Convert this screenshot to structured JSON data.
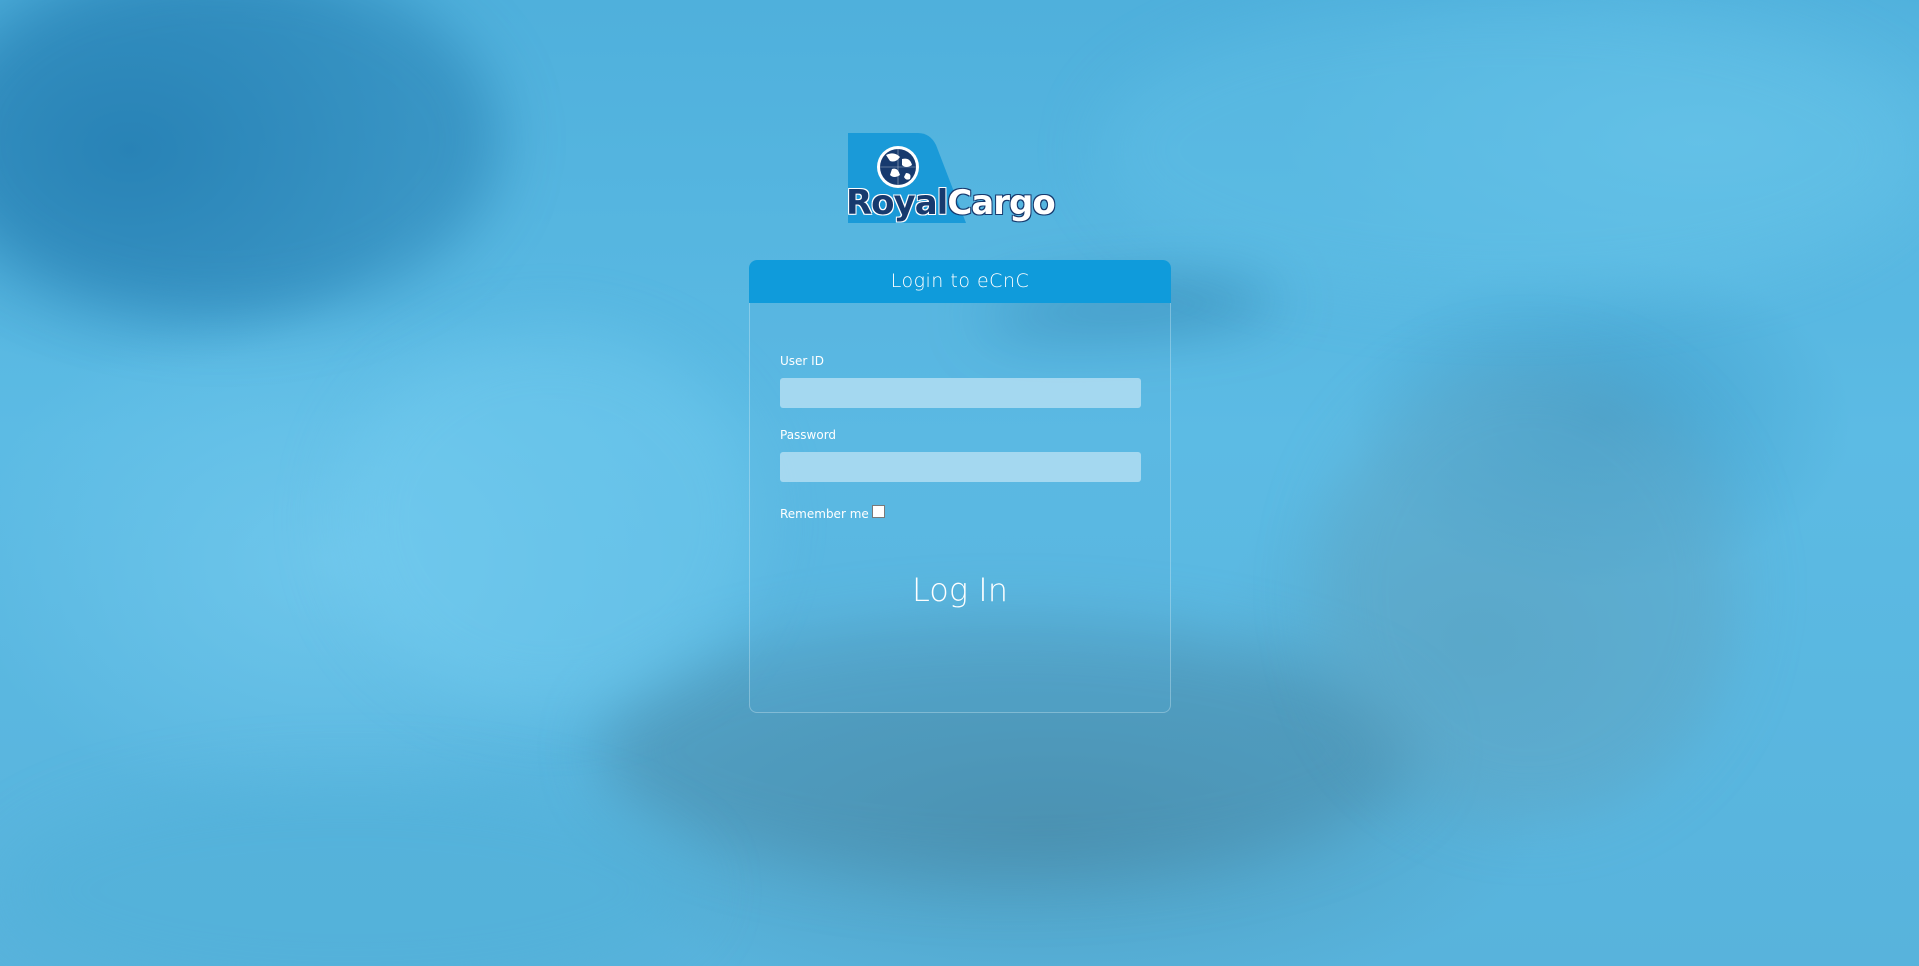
{
  "brand": {
    "logo_royal": "Royal",
    "logo_cargo": "Cargo",
    "logo_icon": "globe-icon",
    "colors": {
      "navy": "#173a6e",
      "accent": "#0f9bdb"
    }
  },
  "login": {
    "title": "Login to eCnC",
    "user_id_label": "User ID",
    "user_id_value": "",
    "password_label": "Password",
    "password_value": "",
    "remember_label": "Remember me",
    "remember_checked": false,
    "submit_label": "Log In"
  }
}
